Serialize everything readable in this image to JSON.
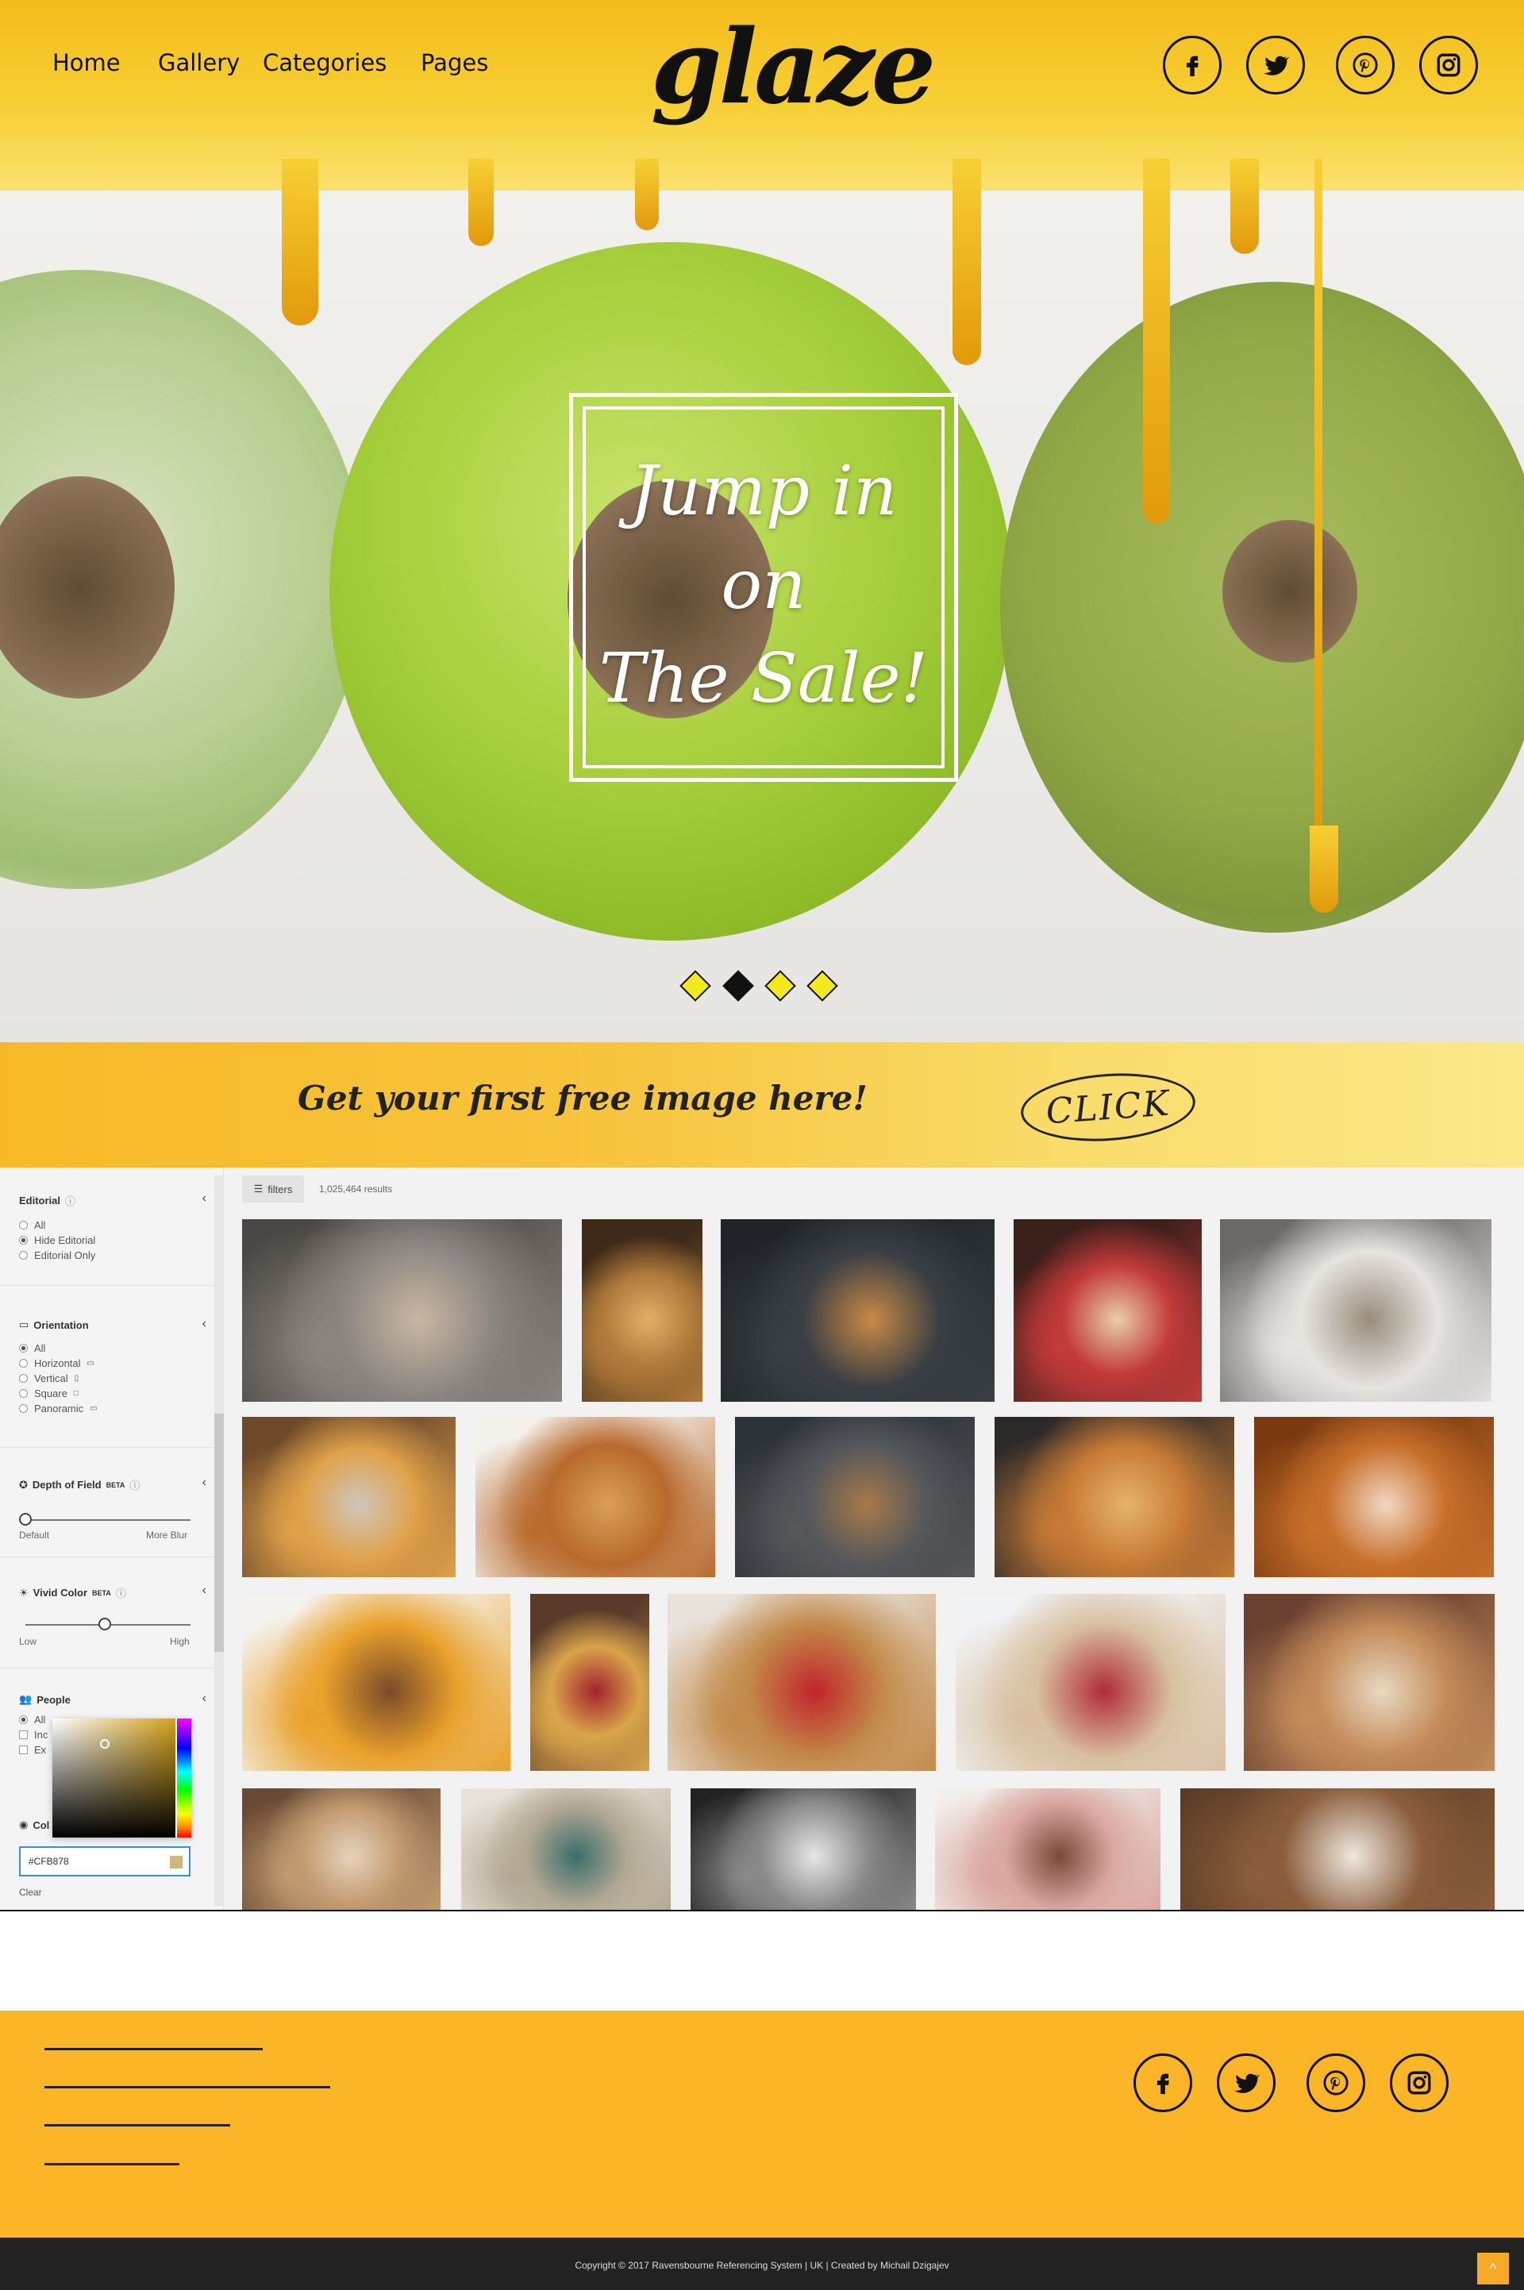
{
  "nav": {
    "items": [
      "Home",
      "Gallery",
      "Categories",
      "Pages"
    ],
    "logo": "glaze"
  },
  "social": [
    "facebook-icon",
    "twitter-icon",
    "pinterest-icon",
    "instagram-icon"
  ],
  "hero": {
    "headline_lines": [
      "Jump in",
      "on",
      "The Sale!"
    ],
    "slides": 4,
    "active_slide": 2
  },
  "banner": {
    "text": "Get your first free image here!",
    "cta": "CLICK"
  },
  "filters_panel": {
    "editorial": {
      "title": "Editorial",
      "options": [
        "All",
        "Hide Editorial",
        "Editorial Only"
      ],
      "selected": "Hide Editorial"
    },
    "orientation": {
      "title": "Orientation",
      "options": [
        "All",
        "Horizontal",
        "Vertical",
        "Square",
        "Panoramic"
      ],
      "selected": "All"
    },
    "depth_of_field": {
      "title": "Depth of Field",
      "badge": "BETA",
      "min_label": "Default",
      "max_label": "More Blur",
      "value": 0
    },
    "vivid_color": {
      "title": "Vivid Color",
      "badge": "BETA",
      "min_label": "Low",
      "max_label": "High",
      "value": 0.5
    },
    "people": {
      "title": "People",
      "options": [
        "All",
        "Inc",
        "Ex"
      ],
      "selected": "All"
    },
    "color": {
      "title_partial": "Col",
      "hex_value": "#CFB878",
      "swatch": "#CFB878",
      "clear_label": "Clear"
    }
  },
  "gallery": {
    "filters_label": "filters",
    "results": "1,025,464 results",
    "thumbnails": [
      {
        "name": "hands-kneading-dough",
        "palette": [
          "#4a4744",
          "#8b8580",
          "#c9b7a3"
        ]
      },
      {
        "name": "bread-basket-wheat",
        "palette": [
          "#3d2a18",
          "#b07a3a",
          "#e0b06a"
        ]
      },
      {
        "name": "dough-rolling-pin-dark",
        "palette": [
          "#202428",
          "#3a3f44",
          "#c98a45"
        ]
      },
      {
        "name": "strawberry-cakes-tray",
        "palette": [
          "#3a1f1a",
          "#c23a3a",
          "#e8cfa8"
        ]
      },
      {
        "name": "chefs-in-kitchen",
        "palette": [
          "#6c6a66",
          "#e6e4e0",
          "#9a8c7c"
        ]
      },
      {
        "name": "croissants-plate",
        "palette": [
          "#6e4a2a",
          "#e0a24a",
          "#cfc6bc"
        ]
      },
      {
        "name": "danish-pastries-white",
        "palette": [
          "#f4f1ec",
          "#b86a2c",
          "#d9a055"
        ]
      },
      {
        "name": "muffin-dark",
        "palette": [
          "#2d3238",
          "#55575a",
          "#a77a4a"
        ]
      },
      {
        "name": "pastries-dark-table",
        "palette": [
          "#2c2a29",
          "#c77a35",
          "#e6b46a"
        ]
      },
      {
        "name": "cupcakes-row",
        "palette": [
          "#7a3a10",
          "#c8702a",
          "#f2d7c4"
        ]
      },
      {
        "name": "breakfast-fruit-pastries",
        "palette": [
          "#f5f3ef",
          "#e9a12a",
          "#7a4a2a"
        ]
      },
      {
        "name": "berry-danish",
        "palette": [
          "#5a3a2a",
          "#d9a44a",
          "#a3232e"
        ]
      },
      {
        "name": "twisted-pastry-milk",
        "palette": [
          "#e8e2da",
          "#c28a4a",
          "#c2242c"
        ]
      },
      {
        "name": "raspberry-pastries-plate",
        "palette": [
          "#f1f3f6",
          "#d8c0a0",
          "#b02a3a"
        ]
      },
      {
        "name": "bakery-display-case",
        "palette": [
          "#6a4030",
          "#c48c5a",
          "#e8d9c2"
        ]
      },
      {
        "name": "baking-ingredients-top",
        "palette": [
          "#6a4a34",
          "#c29b70",
          "#e6d3bb"
        ]
      },
      {
        "name": "baker-woman-moon",
        "palette": [
          "#e9e2d9",
          "#b3a894",
          "#3a6e6a"
        ]
      },
      {
        "name": "chef-plating-bw",
        "palette": [
          "#222222",
          "#8a8a8a",
          "#e6e6e6"
        ]
      },
      {
        "name": "cakes-pink-plate",
        "palette": [
          "#f2eeea",
          "#d9a7a0",
          "#7a4a3a"
        ]
      },
      {
        "name": "flour-eggs-wood",
        "palette": [
          "#5a3a24",
          "#8a5e3c",
          "#efe8de"
        ]
      }
    ]
  },
  "footer": {
    "copyright": "Copyright © 2017 Ravensbourne Referencing System | UK | Created by Michail Dzigajev",
    "to_top": "^"
  }
}
